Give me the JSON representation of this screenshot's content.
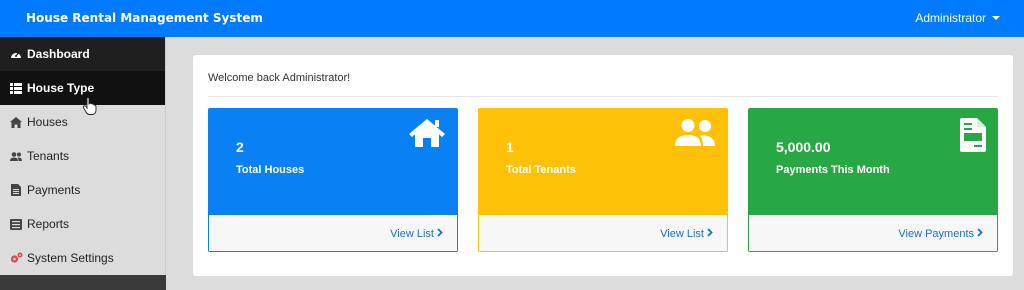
{
  "header": {
    "brand": "House Rental Management System",
    "user": "Administrator"
  },
  "sidebar": {
    "items": [
      {
        "label": "Dashboard",
        "icon": "dashboard-icon"
      },
      {
        "label": "House Type",
        "icon": "list-icon"
      },
      {
        "label": "Houses",
        "icon": "home-icon"
      },
      {
        "label": "Tenants",
        "icon": "users-icon"
      },
      {
        "label": "Payments",
        "icon": "file-icon"
      },
      {
        "label": "Reports",
        "icon": "report-icon"
      },
      {
        "label": "System Settings",
        "icon": "cogs-icon"
      }
    ]
  },
  "main": {
    "welcome": "Welcome back Administrator!",
    "stats": [
      {
        "value": "2",
        "label": "Total Houses",
        "link": "View List",
        "icon": "home-icon",
        "color": "#0a80f5"
      },
      {
        "value": "1",
        "label": "Total Tenants",
        "link": "View List",
        "icon": "users-icon",
        "color": "#ffc107"
      },
      {
        "value": "5,000.00",
        "label": "Payments This Month",
        "link": "View Payments",
        "icon": "file-invoice-icon",
        "color": "#28a745"
      }
    ]
  },
  "colors": {
    "topbar": "#007bff",
    "sidebar_dark": "#1f1f1f",
    "link": "#1a6fd0"
  }
}
